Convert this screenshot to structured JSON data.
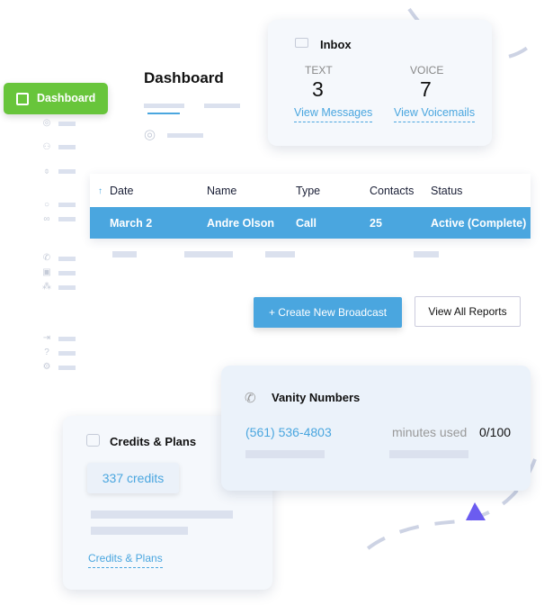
{
  "sidebar": {
    "active_label": "Dashboard",
    "icons": [
      "broadcast-icon",
      "users-icon",
      "microphone-icon",
      "chat-icon",
      "voicemail-icon",
      "phone-icon",
      "box-icon",
      "network-icon",
      "logout-icon",
      "help-icon",
      "settings-icon"
    ]
  },
  "header": {
    "title": "Dashboard"
  },
  "inbox": {
    "title": "Inbox",
    "text_label": "TEXT",
    "text_count": "3",
    "voice_label": "VOICE",
    "voice_count": "7",
    "view_messages": "View Messages",
    "view_voicemails": "View Voicemails"
  },
  "table": {
    "columns": [
      "Date",
      "Name",
      "Type",
      "Contacts",
      "Status"
    ],
    "rows": [
      [
        "March 2",
        "Andre Olson",
        "Call",
        "25",
        "Active (Complete)"
      ]
    ]
  },
  "actions": {
    "create": "+ Create New Broadcast",
    "reports": "View All Reports"
  },
  "vanity": {
    "title": "Vanity Numbers",
    "number": "(561) 536-4803",
    "minutes_label": "minutes used",
    "minutes_value": "0/100"
  },
  "credits": {
    "title": "Credits & Plans",
    "balance": "337 credits",
    "link": "Credits & Plans"
  },
  "colors": {
    "accent_green": "#68c53b",
    "accent_blue": "#4aa6df",
    "arrow_purple": "#6b5cf0"
  }
}
